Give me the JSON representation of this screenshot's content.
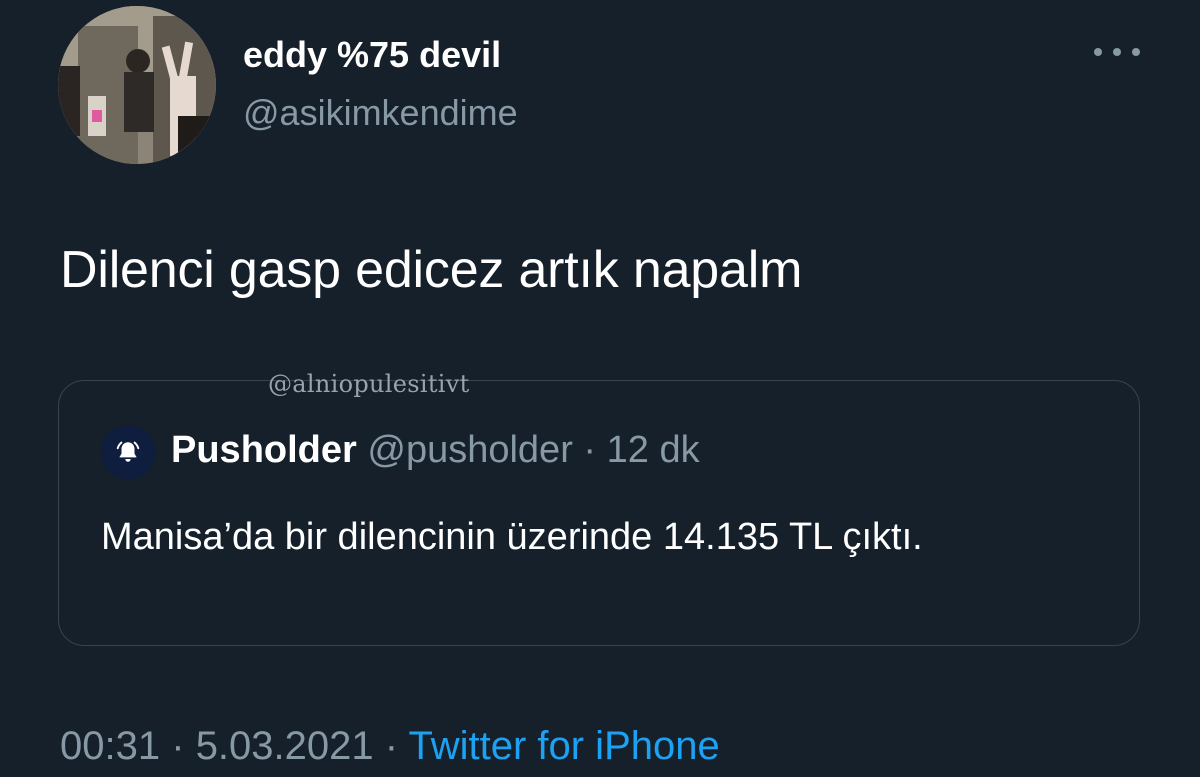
{
  "tweet": {
    "display_name": "eddy %75 devil",
    "username": "@asikimkendime",
    "text": "Dilenci gasp edicez artık napalm",
    "more_icon": "more-horizontal-icon",
    "time": "00:31",
    "date": "5.03.2021",
    "separator": "·",
    "source": "Twitter for iPhone"
  },
  "watermark": "@alniopulesitivt",
  "quote": {
    "avatar_icon": "bell-icon",
    "name": "Pusholder",
    "handle": "@pusholder",
    "separator": "·",
    "time": "12 dk",
    "text": "Manisa’da bir dilencinin üzerinde 14.135 TL çıktı."
  },
  "colors": {
    "background": "#15202b",
    "secondary_text": "#8899a6",
    "link": "#1da1f2",
    "border": "#38444d"
  }
}
